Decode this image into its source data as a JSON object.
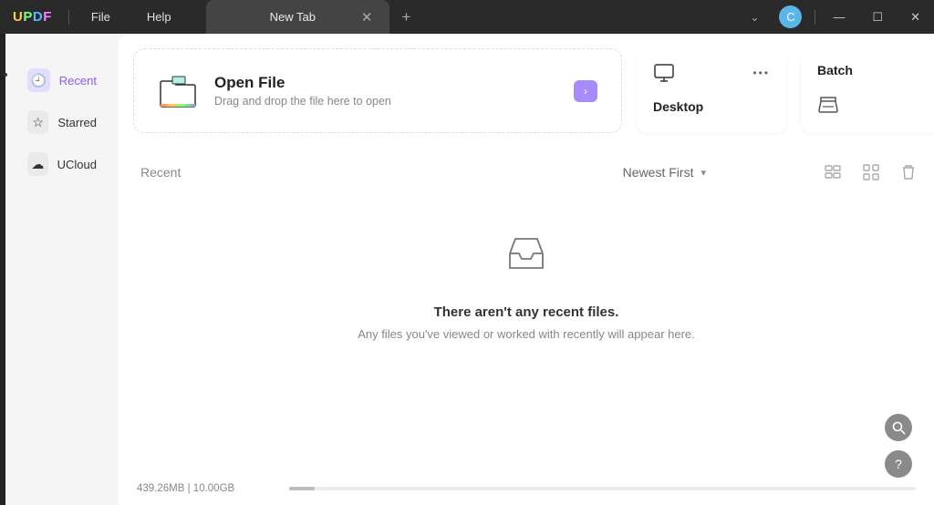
{
  "titlebar": {
    "menus": {
      "file": "File",
      "help": "Help"
    },
    "tab": {
      "title": "New Tab"
    },
    "avatar": "C"
  },
  "sidebar": {
    "recent": "Recent",
    "starred": "Starred",
    "ucloud": "UCloud"
  },
  "open_file": {
    "title": "Open File",
    "subtitle": "Drag and drop the file here to open"
  },
  "desktop_card": {
    "title": "Desktop"
  },
  "batch_card": {
    "title": "Batch"
  },
  "recent_section": {
    "title": "Recent",
    "sort": "Newest First"
  },
  "empty": {
    "title": "There aren't any recent files.",
    "subtitle": "Any files you've viewed or worked with recently will appear here."
  },
  "storage": {
    "text": "439.26MB | 10.00GB"
  }
}
